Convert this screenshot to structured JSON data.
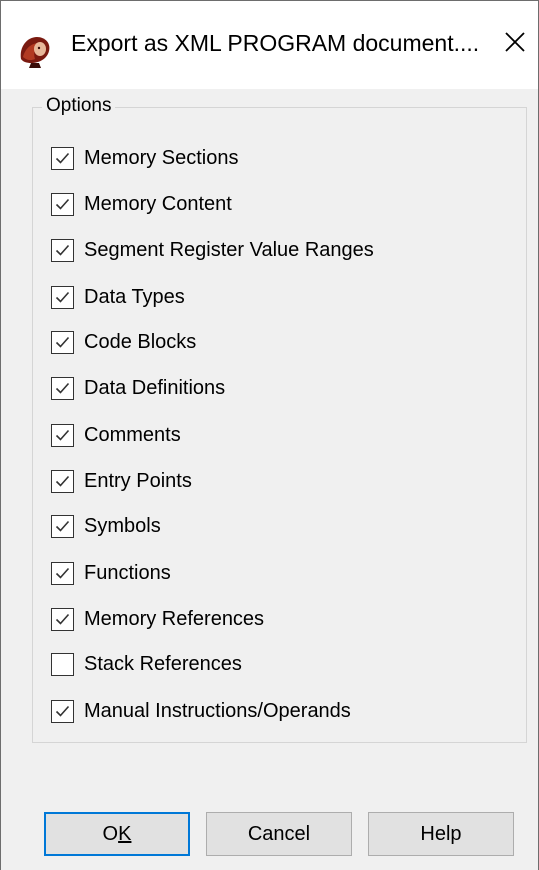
{
  "window": {
    "title": "Export as XML PROGRAM document...."
  },
  "options": {
    "legend": "Options",
    "items": [
      {
        "label": "Memory Sections",
        "checked": true
      },
      {
        "label": "Memory Content",
        "checked": true
      },
      {
        "label": "Segment Register Value Ranges",
        "checked": true
      },
      {
        "label": "Data Types",
        "checked": true
      },
      {
        "label": "Code Blocks",
        "checked": true
      },
      {
        "label": "Data Definitions",
        "checked": true
      },
      {
        "label": "Comments",
        "checked": true
      },
      {
        "label": "Entry Points",
        "checked": true
      },
      {
        "label": "Symbols",
        "checked": true
      },
      {
        "label": "Functions",
        "checked": true
      },
      {
        "label": "Memory References",
        "checked": true
      },
      {
        "label": "Stack References",
        "checked": false
      },
      {
        "label": "Manual Instructions/Operands",
        "checked": true
      }
    ]
  },
  "buttons": {
    "ok_prefix": "O",
    "ok_underlined": "K",
    "cancel": "Cancel",
    "help": "Help"
  },
  "colors": {
    "accent": "#0078d7",
    "dialog_bg": "#f0f0f0"
  },
  "icons": {
    "app": "dragon-app-icon",
    "close": "close-icon",
    "check": "checkmark-icon"
  }
}
